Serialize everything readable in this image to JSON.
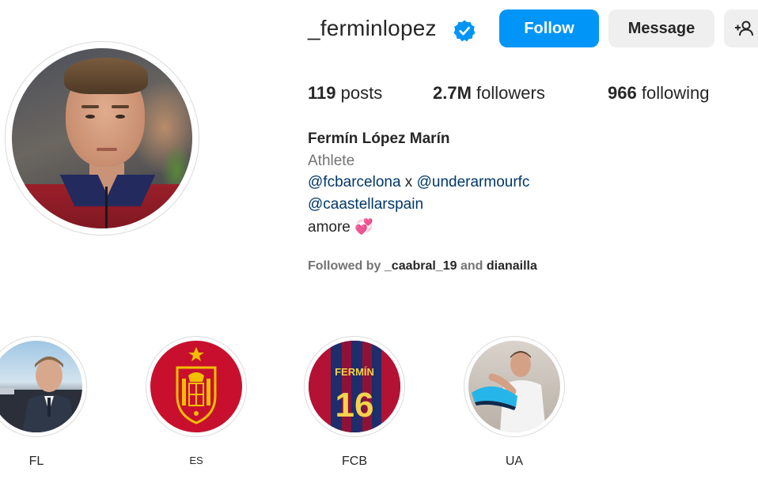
{
  "profile": {
    "username": "_ferminlopez",
    "verified": true,
    "follow_label": "Follow",
    "message_label": "Message",
    "add_user_icon": "person-plus-icon",
    "accent_color": "#0095f6"
  },
  "stats": {
    "posts_count": "119",
    "posts_label": "posts",
    "followers_count": "2.7M",
    "followers_label": "followers",
    "following_count": "966",
    "following_label": "following"
  },
  "bio": {
    "full_name": "Fermín López Marín",
    "category": "Athlete",
    "mention_1": "@fcbarcelona",
    "separator": " x ",
    "mention_2": "@underarmourfc",
    "mention_3": "@caastellarspain",
    "text": "amore",
    "emoji": "💞"
  },
  "followed_by": {
    "prefix": "Followed by ",
    "user_1": "_caabral_19",
    "conjunction": " and ",
    "user_2": "dianailla"
  },
  "highlights": [
    {
      "label": "FL"
    },
    {
      "label": "ES"
    },
    {
      "label": "FCB"
    },
    {
      "label": "UA"
    }
  ]
}
